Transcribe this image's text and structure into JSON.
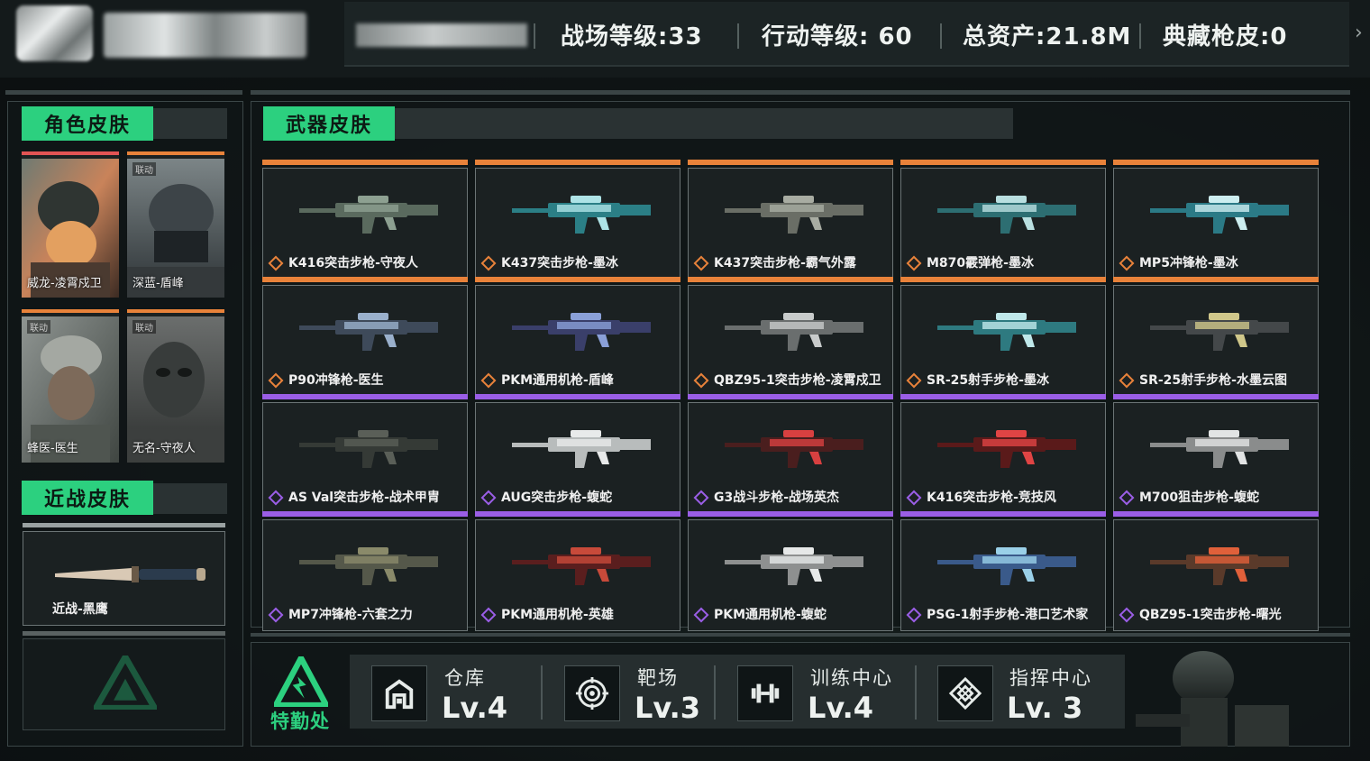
{
  "header": {
    "stats": [
      {
        "label": "战场等级:33"
      },
      {
        "label": "行动等级: 60"
      },
      {
        "label": "总资产:21.8M"
      },
      {
        "label": "典藏枪皮:0"
      }
    ],
    "next_arrow": "›"
  },
  "character_section": {
    "title": "角色皮肤",
    "skins": [
      {
        "name": "威龙-凌霄戍卫",
        "tag": ""
      },
      {
        "name": "深蓝-盾峰",
        "tag": "联动"
      },
      {
        "name": "蜂医-医生",
        "tag": "联动"
      },
      {
        "name": "无名-守夜人",
        "tag": "联动"
      }
    ]
  },
  "melee_section": {
    "title": "近战皮肤",
    "skins": [
      {
        "name": "近战-黑鹰"
      }
    ]
  },
  "weapon_section": {
    "title": "武器皮肤",
    "skins": [
      {
        "name": "K416突击步枪-守夜人",
        "rarity": "orange"
      },
      {
        "name": "K437突击步枪-墨冰",
        "rarity": "orange"
      },
      {
        "name": "K437突击步枪-霸气外露",
        "rarity": "orange"
      },
      {
        "name": "M870霰弹枪-墨冰",
        "rarity": "orange"
      },
      {
        "name": "MP5冲锋枪-墨冰",
        "rarity": "orange"
      },
      {
        "name": "P90冲锋枪-医生",
        "rarity": "orange"
      },
      {
        "name": "PKM通用机枪-盾峰",
        "rarity": "orange"
      },
      {
        "name": "QBZ95-1突击步枪-凌霄戍卫",
        "rarity": "orange"
      },
      {
        "name": "SR-25射手步枪-墨冰",
        "rarity": "orange"
      },
      {
        "name": "SR-25射手步枪-水墨云图",
        "rarity": "orange"
      },
      {
        "name": "AS Val突击步枪-战术甲胄",
        "rarity": "purple"
      },
      {
        "name": "AUG突击步枪-蝮蛇",
        "rarity": "purple"
      },
      {
        "name": "G3战斗步枪-战场英杰",
        "rarity": "purple"
      },
      {
        "name": "K416突击步枪-竞技风",
        "rarity": "purple"
      },
      {
        "name": "M700狙击步枪-蝮蛇",
        "rarity": "purple"
      },
      {
        "name": "MP7冲锋枪-六套之力",
        "rarity": "purple"
      },
      {
        "name": "PKM通用机枪-英雄",
        "rarity": "purple"
      },
      {
        "name": "PKM通用机枪-蝮蛇",
        "rarity": "purple"
      },
      {
        "name": "PSG-1射手步枪-港口艺术家",
        "rarity": "purple"
      },
      {
        "name": "QBZ95-1突击步枪-曙光",
        "rarity": "purple"
      }
    ]
  },
  "facilities": {
    "logo_label": "特勤处",
    "items": [
      {
        "name": "仓库",
        "level": "Lv.4",
        "icon": "warehouse-icon"
      },
      {
        "name": "靶场",
        "level": "Lv.3",
        "icon": "target-icon"
      },
      {
        "name": "训练中心",
        "level": "Lv.4",
        "icon": "dumbbell-icon"
      },
      {
        "name": "指挥中心",
        "level": "Lv. 3",
        "icon": "command-icon"
      }
    ]
  },
  "colors": {
    "accent_green": "#2cd07f",
    "rarity_orange": "#e8823a",
    "rarity_purple": "#9a5ee6"
  }
}
